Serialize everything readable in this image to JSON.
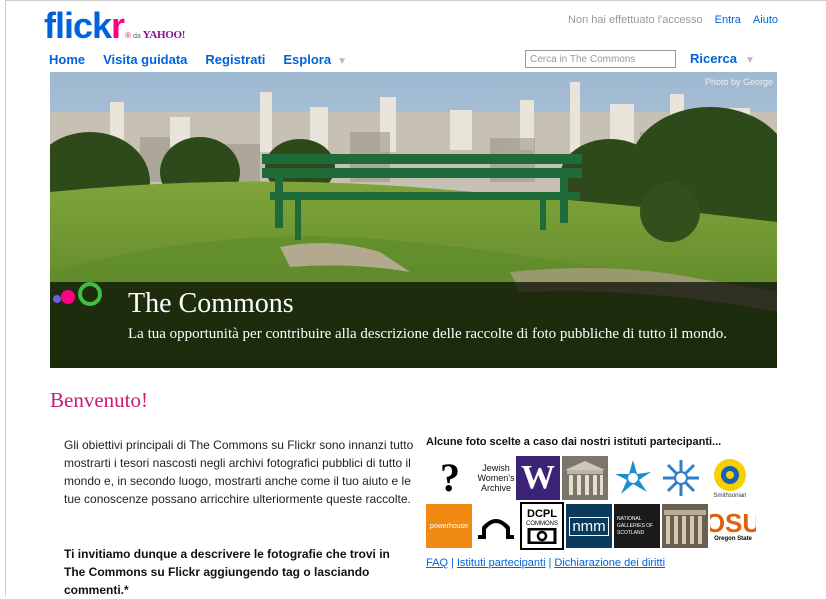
{
  "header": {
    "logo_text_fl": "flick",
    "logo_text_r": "r",
    "logo_reg": "®",
    "logo_da": "da",
    "logo_yahoo": "YAHOO!",
    "not_logged": "Non hai effettuato l'accesso",
    "login": "Entra",
    "help": "Aiuto"
  },
  "nav": {
    "home": "Home",
    "tour": "Visita guidata",
    "register": "Registrati",
    "explore": "Esplora",
    "explore_arrow": "▼"
  },
  "search": {
    "placeholder": "Cerca in The Commons",
    "button": "Ricerca",
    "arrow": "▼"
  },
  "banner": {
    "credit": "Photo by George",
    "title": "The Commons",
    "subtitle": "La tua opportunità per contribuire alla descrizione delle raccolte di foto pubbliche di tutto il mondo."
  },
  "main": {
    "welcome": "Benvenuto!",
    "intro": "Gli obiettivi principali di The Commons su Flickr sono innanzi tutto mostrarti i tesori nascosti negli archivi fotografici pubblici di tutto il mondo e, in secondo luogo, mostrarti anche come il tuo aiuto e le tue conoscenze possano arricchire ulteriormente queste raccolte.",
    "invite": "Ti invitiamo dunque a descrivere le fotografie che trovi in The Commons su Flickr aggiungendo tag o lasciando commenti.*"
  },
  "institutions": {
    "heading": "Alcune foto scelte a caso dai nostri istituti partecipanti...",
    "jewish": [
      "Jewish",
      "Women's",
      "Archive"
    ],
    "w": "W",
    "smithsonian": "Smithsonian",
    "powerhouse": "powerhouse",
    "dcpl": [
      "DCPL",
      "COMMONS"
    ],
    "nmm": "nmm",
    "nls": [
      "NATIONAL",
      "GALLERIES OF",
      "SCOTLAND"
    ],
    "osu": "OSU",
    "osu_sub": "Oregon State"
  },
  "footer_links": {
    "faq": "FAQ",
    "partners": "Istituti partecipanti",
    "rights": "Dichiarazione dei diritti",
    "sep": "|"
  }
}
